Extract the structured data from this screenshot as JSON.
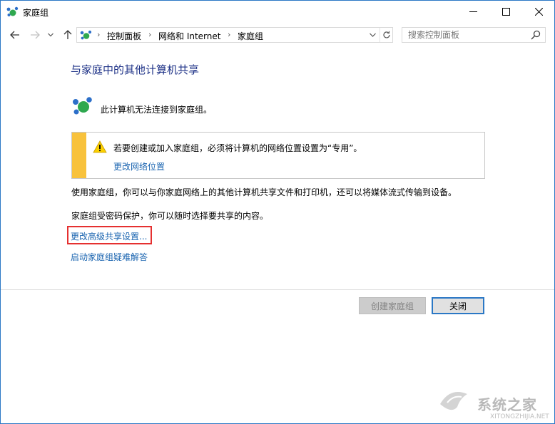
{
  "window": {
    "title": "家庭组",
    "minimize_glyph": "—",
    "maximize_glyph": "☐",
    "close_glyph": "✕"
  },
  "nav": {
    "back_icon": "arrow-left-icon",
    "forward_icon": "arrow-right-icon",
    "recent_icon": "chevron-down-icon",
    "up_icon": "arrow-up-icon",
    "breadcrumbs": [
      "控制面板",
      "网络和 Internet",
      "家庭组"
    ],
    "search_placeholder": "搜索控制面板"
  },
  "content": {
    "heading": "与家庭中的其他计算机共享",
    "status_text": "此计算机无法连接到家庭组。",
    "warning": {
      "text": "若要创建或加入家庭组，必须将计算机的网络位置设置为“专用”。",
      "link": "更改网络位置"
    },
    "para1": "使用家庭组，你可以与你家庭网络上的其他计算机共享文件和打印机，还可以将媒体流式传输到设备。",
    "para2": "家庭组受密码保护，你可以随时选择要共享的内容。",
    "link_advanced": "更改高级共享设置...",
    "link_troubleshoot": "启动家庭组疑难解答"
  },
  "buttons": {
    "create": "创建家庭组",
    "close": "关闭"
  },
  "watermark": {
    "text": "系统之家",
    "url": "XITONGZHIJIA.NET"
  },
  "colors": {
    "heading": "#1e3287",
    "link": "#1a64b0",
    "warning_bar": "#f8c23c",
    "highlight_box": "#e53030",
    "accent_border": "#2b78c5"
  }
}
